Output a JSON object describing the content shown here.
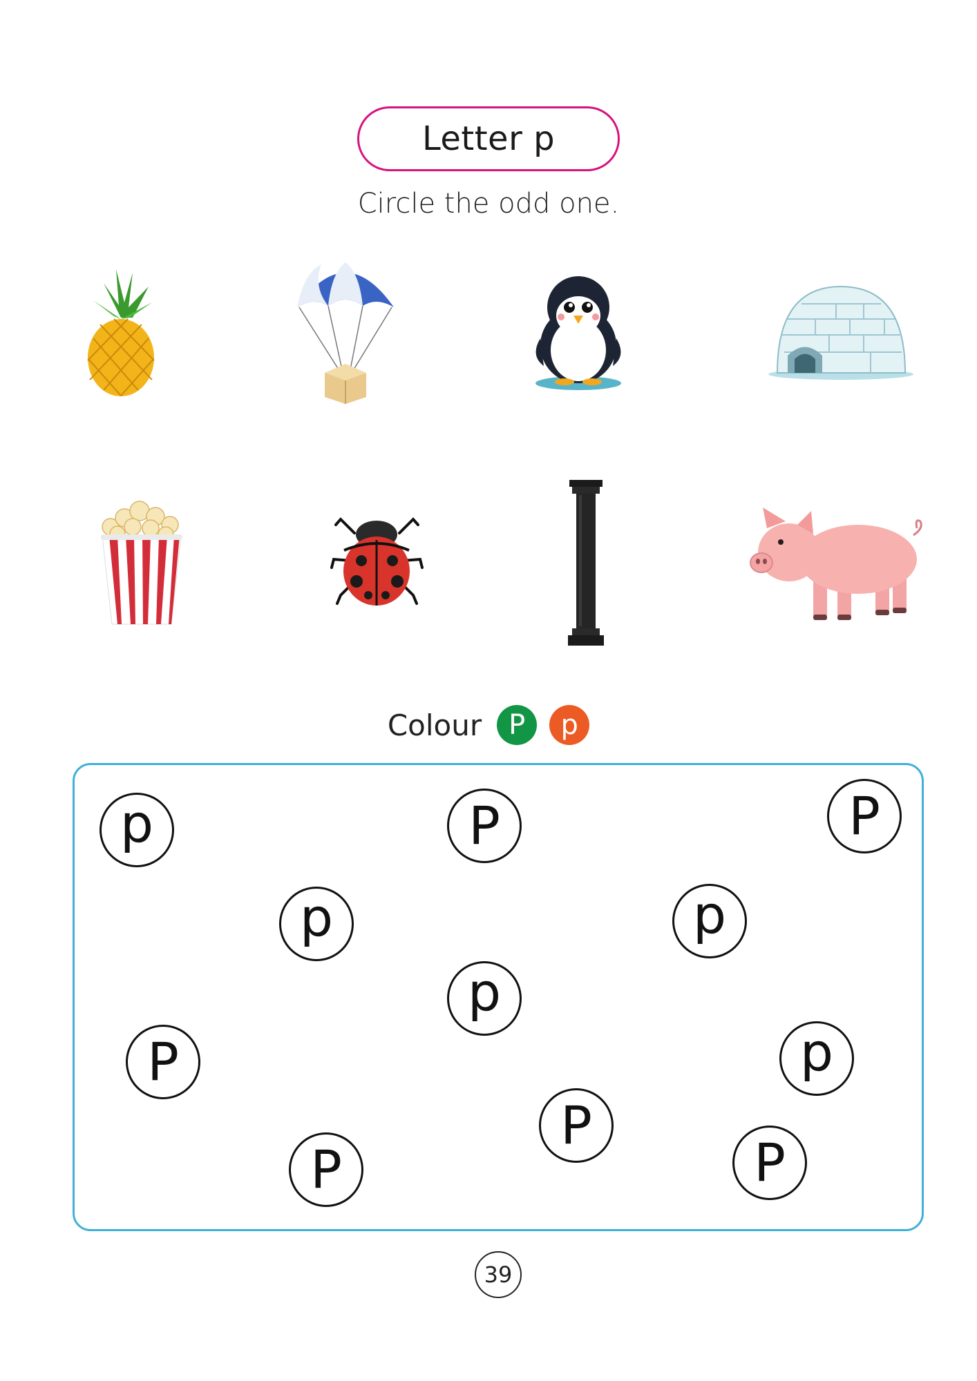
{
  "header": {
    "title": "Letter p",
    "instruction": "Circle the odd one."
  },
  "pictures": [
    {
      "icon": "pineapple-icon"
    },
    {
      "icon": "parachute-icon"
    },
    {
      "icon": "penguin-icon"
    },
    {
      "icon": "igloo-icon"
    },
    {
      "icon": "popcorn-icon"
    },
    {
      "icon": "ladybug-icon"
    },
    {
      "icon": "pillar-icon"
    },
    {
      "icon": "pig-icon"
    }
  ],
  "colour_task": {
    "label": "Colour",
    "chips": [
      {
        "letter": "P",
        "color": "#129645"
      },
      {
        "letter": "p",
        "color": "#ec5b24"
      }
    ]
  },
  "letters": [
    "p",
    "P",
    "P",
    "p",
    "p",
    "p",
    "P",
    "p",
    "P",
    "P",
    "P"
  ],
  "page_number": "39"
}
